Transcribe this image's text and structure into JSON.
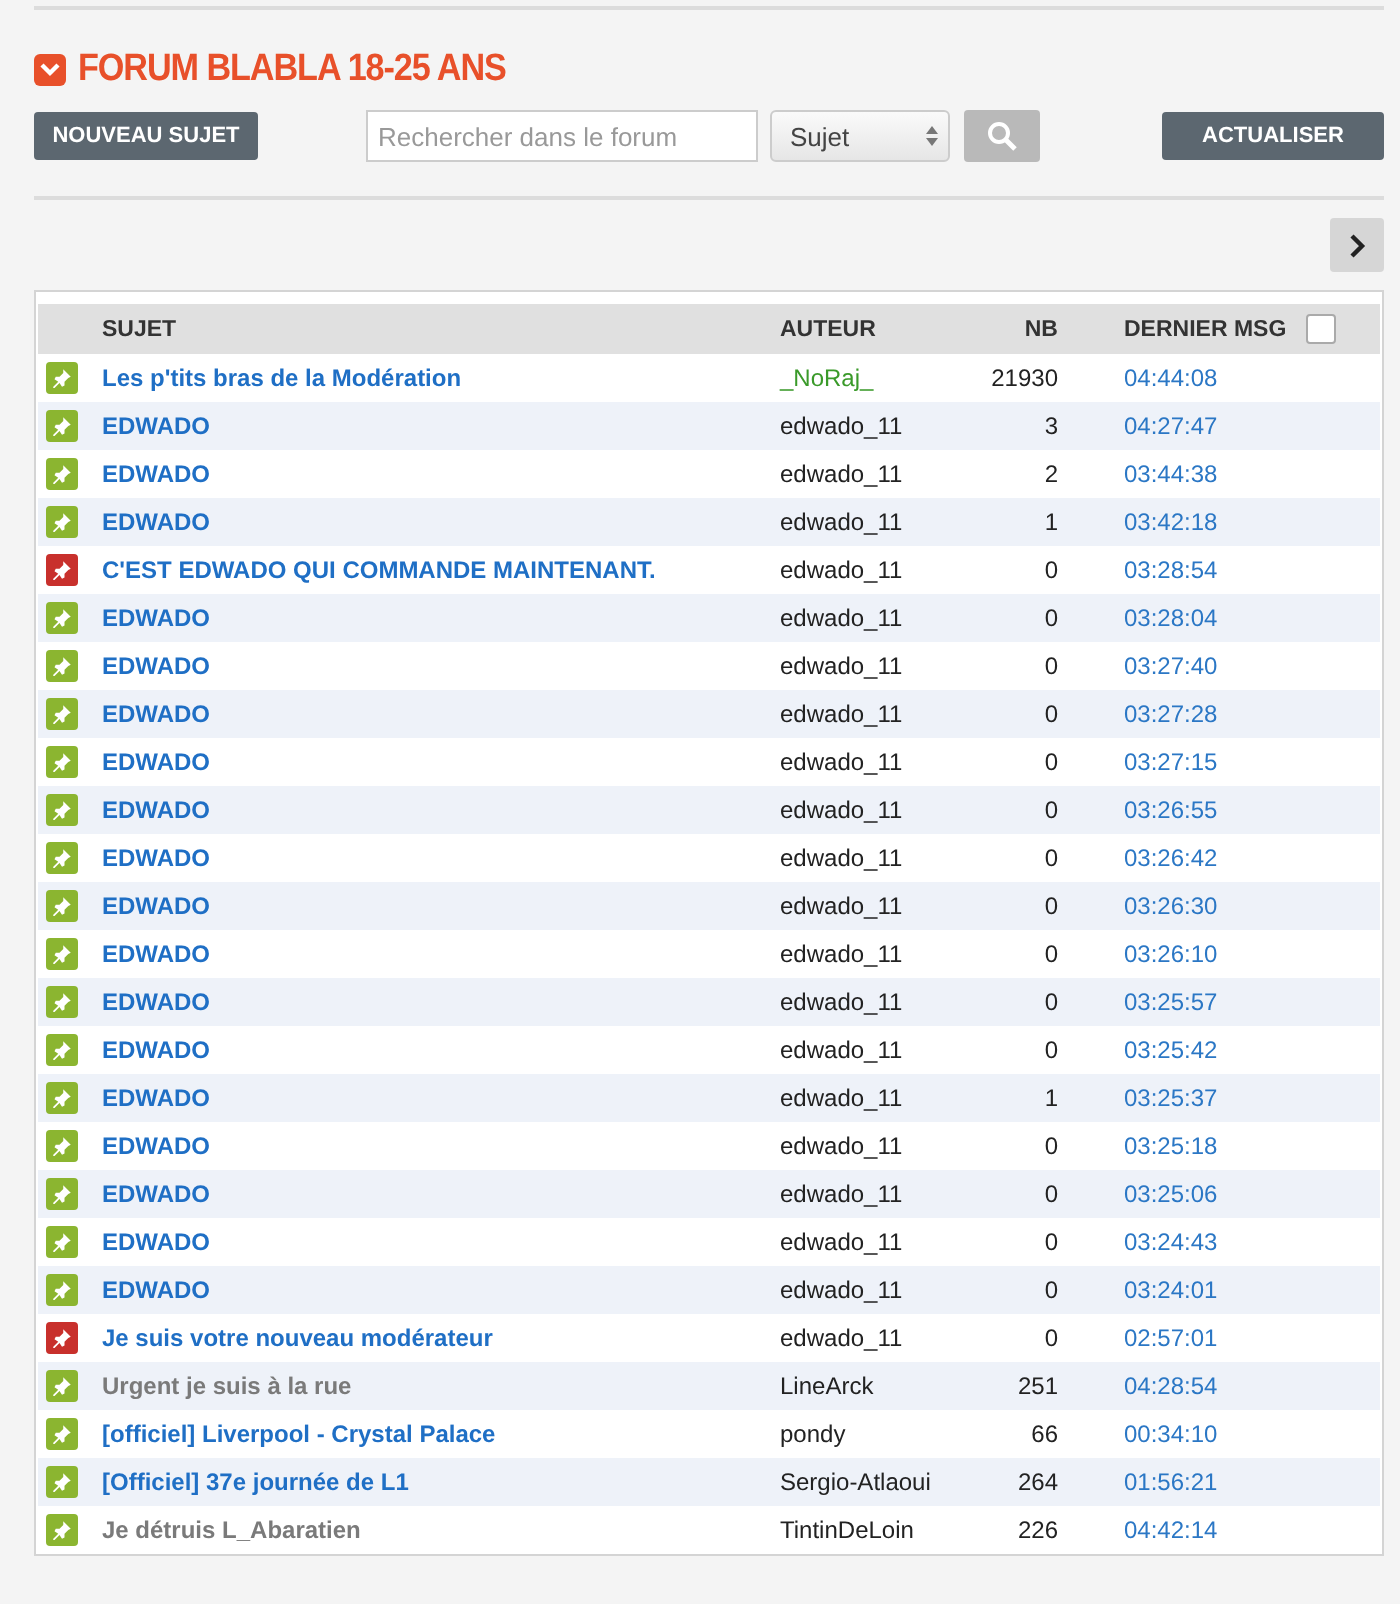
{
  "forum_title": "FORUM BLABLA 18-25 ANS",
  "toolbar": {
    "new_topic_button": "NOUVEAU SUJET",
    "search": {
      "placeholder": "Rechercher dans le forum"
    },
    "search_scope": "Sujet",
    "refresh_button": "ACTUALISER"
  },
  "pagination": {
    "next_enabled": true
  },
  "table": {
    "columns": [
      "SUJET",
      "AUTEUR",
      "NB",
      "DERNIER MSG"
    ],
    "select_all_checked": false,
    "rows": [
      {
        "kind": "normal",
        "subject": "Les p'tits bras de la Modération",
        "visited": false,
        "author": "_NoRaj_",
        "author_moderator": true,
        "count": "21930",
        "last_msg": "04:44:08"
      },
      {
        "kind": "normal",
        "subject": "EDWADO",
        "visited": false,
        "author": "edwado_11",
        "author_moderator": false,
        "count": "3",
        "last_msg": "04:27:47"
      },
      {
        "kind": "normal",
        "subject": "EDWADO",
        "visited": false,
        "author": "edwado_11",
        "author_moderator": false,
        "count": "2",
        "last_msg": "03:44:38"
      },
      {
        "kind": "normal",
        "subject": "EDWADO",
        "visited": false,
        "author": "edwado_11",
        "author_moderator": false,
        "count": "1",
        "last_msg": "03:42:18"
      },
      {
        "kind": "flagged",
        "subject": "C'EST EDWADO QUI COMMANDE MAINTENANT.",
        "visited": false,
        "author": "edwado_11",
        "author_moderator": false,
        "count": "0",
        "last_msg": "03:28:54"
      },
      {
        "kind": "normal",
        "subject": "EDWADO",
        "visited": false,
        "author": "edwado_11",
        "author_moderator": false,
        "count": "0",
        "last_msg": "03:28:04"
      },
      {
        "kind": "normal",
        "subject": "EDWADO",
        "visited": false,
        "author": "edwado_11",
        "author_moderator": false,
        "count": "0",
        "last_msg": "03:27:40"
      },
      {
        "kind": "normal",
        "subject": "EDWADO",
        "visited": false,
        "author": "edwado_11",
        "author_moderator": false,
        "count": "0",
        "last_msg": "03:27:28"
      },
      {
        "kind": "normal",
        "subject": "EDWADO",
        "visited": false,
        "author": "edwado_11",
        "author_moderator": false,
        "count": "0",
        "last_msg": "03:27:15"
      },
      {
        "kind": "normal",
        "subject": "EDWADO",
        "visited": false,
        "author": "edwado_11",
        "author_moderator": false,
        "count": "0",
        "last_msg": "03:26:55"
      },
      {
        "kind": "normal",
        "subject": "EDWADO",
        "visited": false,
        "author": "edwado_11",
        "author_moderator": false,
        "count": "0",
        "last_msg": "03:26:42"
      },
      {
        "kind": "normal",
        "subject": "EDWADO",
        "visited": false,
        "author": "edwado_11",
        "author_moderator": false,
        "count": "0",
        "last_msg": "03:26:30"
      },
      {
        "kind": "normal",
        "subject": "EDWADO",
        "visited": false,
        "author": "edwado_11",
        "author_moderator": false,
        "count": "0",
        "last_msg": "03:26:10"
      },
      {
        "kind": "normal",
        "subject": "EDWADO",
        "visited": false,
        "author": "edwado_11",
        "author_moderator": false,
        "count": "0",
        "last_msg": "03:25:57"
      },
      {
        "kind": "normal",
        "subject": "EDWADO",
        "visited": false,
        "author": "edwado_11",
        "author_moderator": false,
        "count": "0",
        "last_msg": "03:25:42"
      },
      {
        "kind": "normal",
        "subject": "EDWADO",
        "visited": false,
        "author": "edwado_11",
        "author_moderator": false,
        "count": "1",
        "last_msg": "03:25:37"
      },
      {
        "kind": "normal",
        "subject": "EDWADO",
        "visited": false,
        "author": "edwado_11",
        "author_moderator": false,
        "count": "0",
        "last_msg": "03:25:18"
      },
      {
        "kind": "normal",
        "subject": "EDWADO",
        "visited": false,
        "author": "edwado_11",
        "author_moderator": false,
        "count": "0",
        "last_msg": "03:25:06"
      },
      {
        "kind": "normal",
        "subject": "EDWADO",
        "visited": false,
        "author": "edwado_11",
        "author_moderator": false,
        "count": "0",
        "last_msg": "03:24:43"
      },
      {
        "kind": "normal",
        "subject": "EDWADO",
        "visited": false,
        "author": "edwado_11",
        "author_moderator": false,
        "count": "0",
        "last_msg": "03:24:01"
      },
      {
        "kind": "flagged",
        "subject": "Je suis votre nouveau modérateur",
        "visited": false,
        "author": "edwado_11",
        "author_moderator": false,
        "count": "0",
        "last_msg": "02:57:01"
      },
      {
        "kind": "normal",
        "subject": "Urgent je suis à la rue",
        "visited": true,
        "author": "LineArck",
        "author_moderator": false,
        "count": "251",
        "last_msg": "04:28:54"
      },
      {
        "kind": "normal",
        "subject": "[officiel] Liverpool - Crystal Palace",
        "visited": false,
        "author": "pondy",
        "author_moderator": false,
        "count": "66",
        "last_msg": "00:34:10"
      },
      {
        "kind": "normal",
        "subject": "[Officiel] 37e journée de L1",
        "visited": false,
        "author": "Sergio-Atlaoui",
        "author_moderator": false,
        "count": "264",
        "last_msg": "01:56:21"
      },
      {
        "kind": "normal",
        "subject": "Je détruis L_Abaratien",
        "visited": true,
        "author": "TintinDeLoin",
        "author_moderator": false,
        "count": "226",
        "last_msg": "04:42:14"
      }
    ]
  }
}
